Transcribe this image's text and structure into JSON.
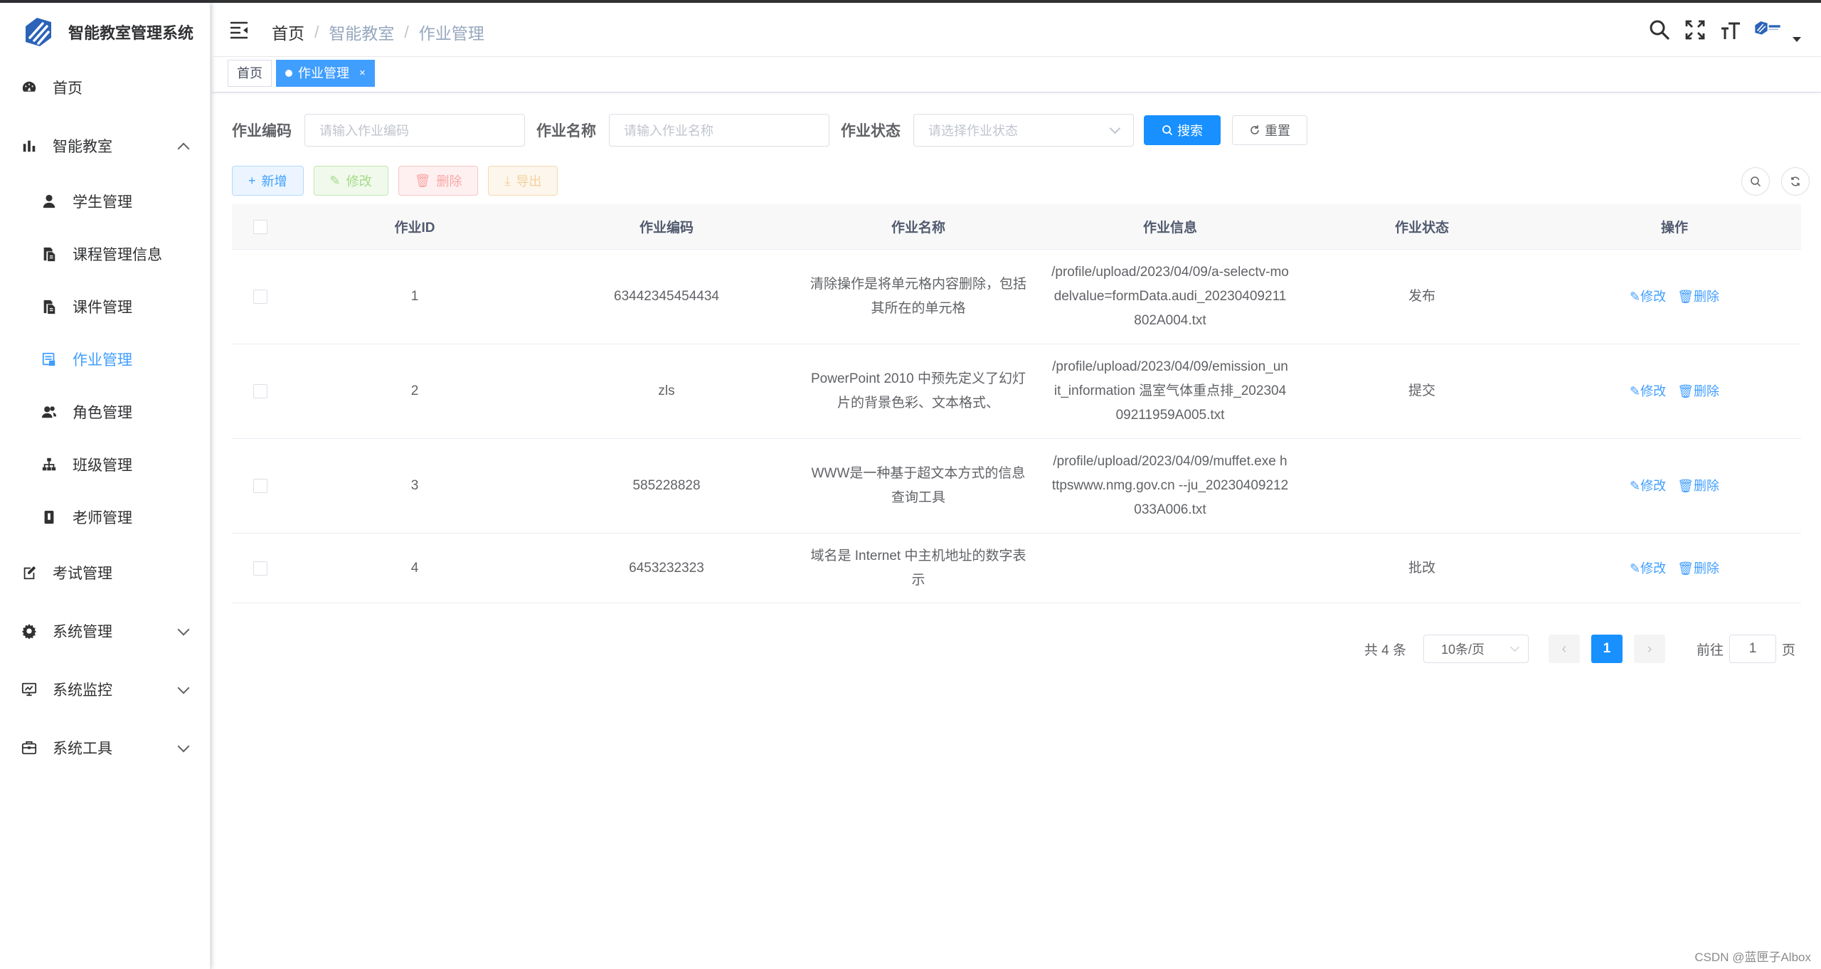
{
  "app": {
    "title": "智能教室管理系统"
  },
  "sidebar": {
    "items": [
      {
        "label": "首页",
        "icon": "dashboard-icon"
      },
      {
        "label": "智能教室",
        "icon": "chart-icon",
        "expanded": true,
        "children": [
          {
            "label": "学生管理",
            "icon": "user-icon"
          },
          {
            "label": "课程管理信息",
            "icon": "copy-icon"
          },
          {
            "label": "课件管理",
            "icon": "copy-icon"
          },
          {
            "label": "作业管理",
            "icon": "list-icon",
            "active": true
          },
          {
            "label": "角色管理",
            "icon": "peoples-icon"
          },
          {
            "label": "班级管理",
            "icon": "tree-icon"
          },
          {
            "label": "老师管理",
            "icon": "education-icon"
          }
        ]
      },
      {
        "label": "考试管理",
        "icon": "edit-icon"
      },
      {
        "label": "系统管理",
        "icon": "gear-icon"
      },
      {
        "label": "系统监控",
        "icon": "monitor-icon"
      },
      {
        "label": "系统工具",
        "icon": "tool-icon"
      }
    ]
  },
  "breadcrumb": [
    "首页",
    "智能教室",
    "作业管理"
  ],
  "tags": {
    "home": "首页",
    "current": "作业管理",
    "close": "×"
  },
  "search": {
    "code_label": "作业编码",
    "code_placeholder": "请输入作业编码",
    "name_label": "作业名称",
    "name_placeholder": "请输入作业名称",
    "status_label": "作业状态",
    "status_placeholder": "请选择作业状态",
    "search_btn": "搜索",
    "reset_btn": "重置"
  },
  "toolbar": {
    "add": "新增",
    "edit": "修改",
    "delete": "删除",
    "export": "导出"
  },
  "table": {
    "headers": [
      "作业ID",
      "作业编码",
      "作业名称",
      "作业信息",
      "作业状态",
      "操作"
    ],
    "rows": [
      {
        "id": "1",
        "code": "63442345454434",
        "name": "清除操作是将单元格内容删除，包括其所在的单元格",
        "info": "/profile/upload/2023/04/09/a-selectv-modelvalue=formData.audi_20230409211802A004.txt",
        "status": "发布"
      },
      {
        "id": "2",
        "code": "zls",
        "name": "PowerPoint 2010 中预先定义了幻灯片的背景色彩、文本格式、",
        "info": "/profile/upload/2023/04/09/emission_unit_information 温室气体重点排_20230409211959A005.txt",
        "status": "提交"
      },
      {
        "id": "3",
        "code": "585228828",
        "name": "WWW是一种基于超文本方式的信息查询工具",
        "info": "/profile/upload/2023/04/09/muffet.exe httpswww.nmg.gov.cn --ju_20230409212033A006.txt",
        "status": ""
      },
      {
        "id": "4",
        "code": "6453232323",
        "name": "域名是 Internet 中主机地址的数字表示",
        "info": "",
        "status": "批改"
      }
    ],
    "op_edit": "修改",
    "op_delete": "删除"
  },
  "pagination": {
    "total": "共 4 条",
    "page_size": "10条/页",
    "current": "1",
    "goto_label": "前往",
    "goto_value": "1",
    "page_unit": "页"
  },
  "watermark": "CSDN @蓝匣子Albox",
  "colors": {
    "primary": "#1890ff",
    "link": "#409eff",
    "active_menu": "#409eff"
  }
}
